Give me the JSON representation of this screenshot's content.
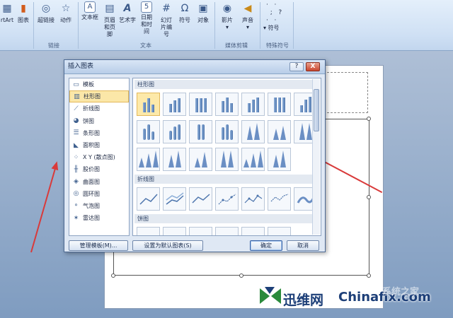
{
  "ribbon": {
    "buttons": [
      {
        "label": "rtArt",
        "icon": "smartart-icon"
      },
      {
        "label": "图表",
        "icon": "chart-icon"
      },
      {
        "label": "超链接",
        "icon": "hyperlink-icon"
      },
      {
        "label": "动作",
        "icon": "action-icon"
      },
      {
        "label": "文本框",
        "icon": "textbox-icon"
      },
      {
        "label": "页眉和页脚",
        "icon": "header-footer-icon"
      },
      {
        "label": "艺术字",
        "icon": "wordart-icon"
      },
      {
        "label": "日期和时间",
        "icon": "date-time-icon"
      },
      {
        "label": "幻灯片编号",
        "icon": "slide-number-icon"
      },
      {
        "label": "符号",
        "icon": "symbol-icon"
      },
      {
        "label": "对象",
        "icon": "object-icon"
      },
      {
        "label": "影片",
        "icon": "movie-icon"
      },
      {
        "label": "声音",
        "icon": "sound-icon"
      },
      {
        "label": "符号",
        "icon": "special-symbol-icon"
      }
    ],
    "groups": [
      "链接",
      "文本",
      "媒体剪辑",
      "特殊符号"
    ]
  },
  "dialog": {
    "title": "插入图表",
    "help_label": "?",
    "close_label": "X",
    "categories": [
      {
        "label": "模板",
        "icon": "folder-icon"
      },
      {
        "label": "柱形图",
        "icon": "column-chart-icon",
        "selected": true
      },
      {
        "label": "折线图",
        "icon": "line-chart-icon"
      },
      {
        "label": "饼图",
        "icon": "pie-chart-icon"
      },
      {
        "label": "条形图",
        "icon": "bar-chart-icon"
      },
      {
        "label": "面积图",
        "icon": "area-chart-icon"
      },
      {
        "label": "X Y (散点图)",
        "icon": "scatter-chart-icon"
      },
      {
        "label": "股价图",
        "icon": "stock-chart-icon"
      },
      {
        "label": "曲面图",
        "icon": "surface-chart-icon"
      },
      {
        "label": "圆环图",
        "icon": "doughnut-chart-icon"
      },
      {
        "label": "气泡图",
        "icon": "bubble-chart-icon"
      },
      {
        "label": "雷达图",
        "icon": "radar-chart-icon"
      }
    ],
    "sections": [
      "柱形图",
      "折线图",
      "饼图"
    ],
    "buttons": {
      "manage": "管理模板(M)...",
      "set_default": "设置为默认图表(S)",
      "ok": "确定",
      "cancel": "取消"
    }
  },
  "watermark": {
    "brand_cn": "迅维网",
    "brand_en": "Chinafix.com",
    "faint": "系统之家"
  },
  "colors": {
    "accent": "#fbe7a8",
    "arrow": "#d93a3a"
  }
}
